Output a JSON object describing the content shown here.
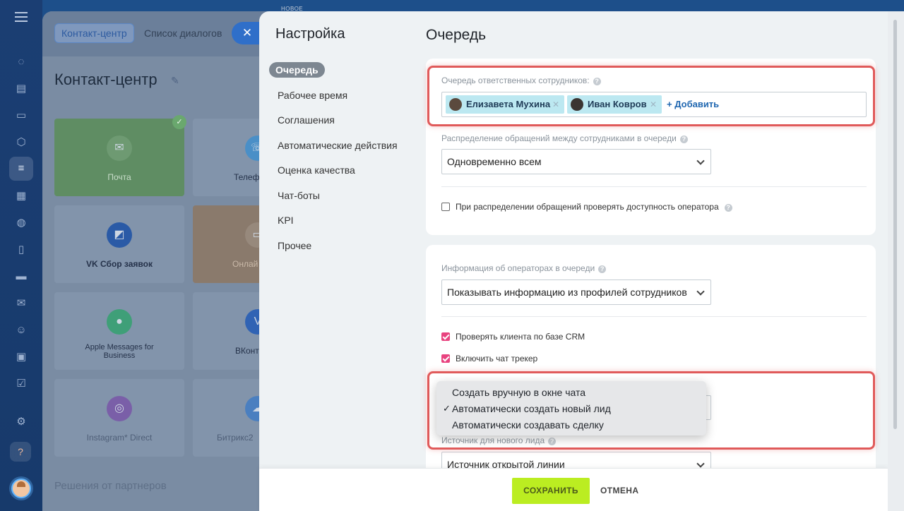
{
  "background": {
    "tabs": [
      "Контакт-центр",
      "Список диалогов"
    ],
    "close_glyph": "✕",
    "title": "Контакт-центр",
    "tiles": [
      {
        "label": "Почта",
        "icon": "mail-icon"
      },
      {
        "label": "Телеф",
        "icon": "phone-icon"
      },
      {
        "label": "VK Сбор заявок",
        "icon": "vk-forms-icon"
      },
      {
        "label": "Онлай",
        "icon": "chat-icon"
      },
      {
        "label": "Apple Messages for Business",
        "icon": "apple-messages-icon"
      },
      {
        "label": "ВКонт",
        "icon": "vk-icon"
      },
      {
        "label": "Instagram* Direct",
        "icon": "instagram-icon"
      },
      {
        "label": "Битрикс2",
        "icon": "bitrix24-icon"
      }
    ],
    "partners": "Решения от партнеров"
  },
  "slider": {
    "new_label": "НОВОЕ",
    "title": "Настройка",
    "nav": [
      "Очередь",
      "Рабочее время",
      "Соглашения",
      "Автоматические действия",
      "Оценка качества",
      "Чат-боты",
      "KPI",
      "Прочее"
    ],
    "active_nav": "Очередь"
  },
  "queue": {
    "title": "Очередь",
    "employees_label": "Очередь ответственных сотрудников:",
    "employees": [
      "Елизавета Мухина",
      "Иван Ковров"
    ],
    "add_label": "+ Добавить",
    "distribution_label": "Распределение обращений между сотрудниками в очереди",
    "distribution_value": "Одновременно всем",
    "check_availability": "При распределении обращений проверять доступность оператора",
    "operators_info_label": "Информация об операторах в очереди",
    "operators_info_value": "Показывать информацию из профилей сотрудников",
    "check_crm": "Проверять клиента по базе CRM",
    "chat_tracker": "Включить чат трекер",
    "lead_options": [
      "Создать вручную в окне чата",
      "Автоматически создать новый лид",
      "Автоматически создавать сделку"
    ],
    "lead_selected": "Автоматически создать новый лид",
    "check_mark": "✓",
    "source_label": "Источник для нового лида",
    "source_value": "Источник открытой линии"
  },
  "footer": {
    "save": "СОХРАНИТЬ",
    "cancel": "ОТМЕНА"
  },
  "colors": {
    "accent_green": "#bbed21",
    "checkbox_pink": "#e8437f",
    "highlight_red": "#e05a5a",
    "tag_blue": "#bce8f1"
  }
}
